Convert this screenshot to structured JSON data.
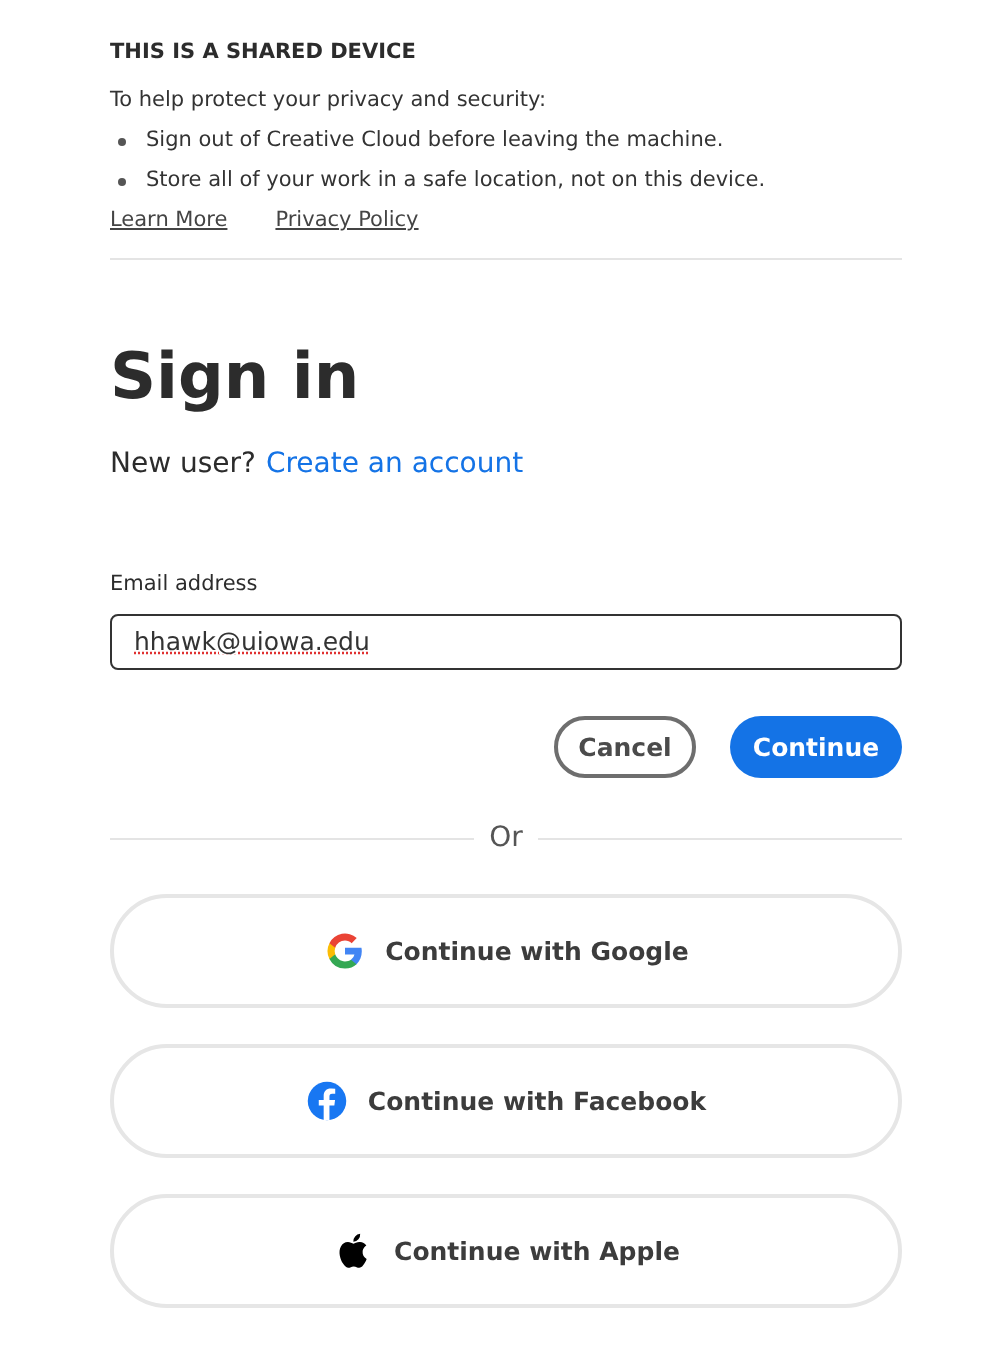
{
  "notice": {
    "title": "THIS IS A SHARED DEVICE",
    "intro": "To help protect your privacy and security:",
    "bullets": [
      "Sign out of Creative Cloud before leaving the machine.",
      "Store all of your work in a safe location, not on this device."
    ],
    "links": [
      "Learn More",
      "Privacy Policy"
    ]
  },
  "heading": "Sign in",
  "new_user": {
    "prompt": "New user?",
    "link": "Create an account"
  },
  "email": {
    "label": "Email address",
    "value": "hhawk@uiowa.edu",
    "misspelled": true
  },
  "buttons": [
    {
      "label": "Cancel",
      "kind": "secondary"
    },
    {
      "label": "Continue",
      "kind": "primary"
    }
  ],
  "separator": "Or",
  "social": [
    {
      "label": "Continue with Google",
      "kind": "google"
    },
    {
      "label": "Continue with Facebook",
      "kind": "facebook"
    },
    {
      "label": "Continue with Apple",
      "kind": "apple"
    }
  ]
}
